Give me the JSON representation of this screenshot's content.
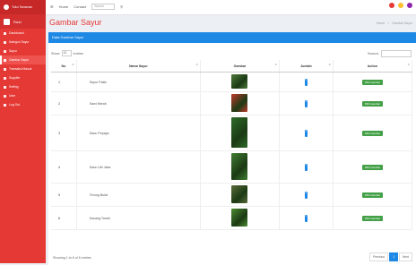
{
  "brand": {
    "title": "Toko Tanaman"
  },
  "topnav": {
    "home": "Home",
    "contact": "Contact",
    "search_placeholder": "Search"
  },
  "sidebar": {
    "user": "Rizki",
    "items": [
      {
        "label": "Dashboard"
      },
      {
        "label": "Kategori Sayur"
      },
      {
        "label": "Sayur"
      },
      {
        "label": "Gambar Sayur"
      },
      {
        "label": "Transaksi Masuk"
      },
      {
        "label": "Supplier"
      },
      {
        "label": "Setting"
      },
      {
        "label": "User"
      },
      {
        "label": "Log Out"
      }
    ]
  },
  "page": {
    "title": "Gambar Sayur",
    "crumb_home": "Home",
    "crumb_current": "Gambar Sayur"
  },
  "box": {
    "header": "Data Gambar Sayur"
  },
  "controls": {
    "show_label": "Show",
    "show_value": "10",
    "entries_label": "entries",
    "search_label": "Search:"
  },
  "table": {
    "headers": [
      "No",
      "Nama Sayur",
      "Gambar",
      "Jumlah",
      "Action"
    ],
    "rows": [
      {
        "no": "1",
        "name": "Sayur Pakis",
        "color": "#4e7a3a",
        "count": "1",
        "action": "Pilih Gambar"
      },
      {
        "no": "2",
        "name": "Sawi Merah",
        "color": "#c0392b",
        "count": "1",
        "action": "Pilih Gambar"
      },
      {
        "no": "3",
        "name": "Daun Pepaya",
        "color": "#2e6b2a",
        "count": "1",
        "action": "Pilih Gambar"
      },
      {
        "no": "4",
        "name": "Daun Ubi Jalar",
        "color": "#3f7d33",
        "count": "1",
        "action": "Pilih Gambar"
      },
      {
        "no": "5",
        "name": "Terung Bulat",
        "color": "#5b6b3a",
        "count": "1",
        "action": "Pilih Gambar"
      },
      {
        "no": "6",
        "name": "Kacang Tanah",
        "color": "#4a8a30",
        "count": "1",
        "action": "Pilih Gambar"
      }
    ]
  },
  "footer": {
    "info": "Showing 1 to 6 of 6 entries",
    "prev": "Previous",
    "page": "1",
    "next": "Next"
  }
}
